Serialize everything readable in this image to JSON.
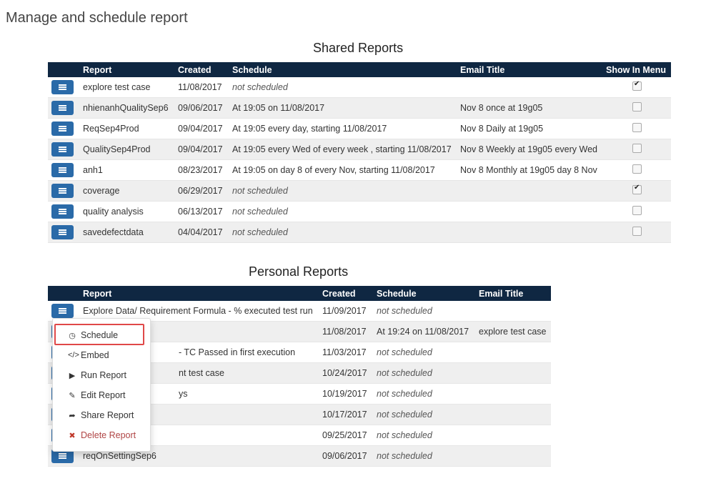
{
  "page": {
    "title": "Manage and schedule report"
  },
  "shared": {
    "title": "Shared Reports",
    "headers": {
      "report": "Report",
      "created": "Created",
      "schedule": "Schedule",
      "email": "Email Title",
      "show": "Show In Menu"
    },
    "rows": [
      {
        "name": "explore test case",
        "created": "11/08/2017",
        "schedule": "not scheduled",
        "email": "",
        "show": true
      },
      {
        "name": "nhienanhQualitySep6",
        "created": "09/06/2017",
        "schedule": "At 19:05 on 11/08/2017",
        "email": "Nov 8 once at 19g05",
        "show": false
      },
      {
        "name": "ReqSep4Prod",
        "created": "09/04/2017",
        "schedule": "At 19:05 every day, starting 11/08/2017",
        "email": "Nov 8 Daily at 19g05",
        "show": false
      },
      {
        "name": "QualitySep4Prod",
        "created": "09/04/2017",
        "schedule": "At 19:05 every Wed of every week , starting 11/08/2017",
        "email": "Nov 8 Weekly at 19g05 every Wed",
        "show": false
      },
      {
        "name": "anh1",
        "created": "08/23/2017",
        "schedule": "At 19:05 on day 8 of every Nov, starting 11/08/2017",
        "email": "Nov 8 Monthly at 19g05 day 8 Nov",
        "show": false
      },
      {
        "name": "coverage",
        "created": "06/29/2017",
        "schedule": "not scheduled",
        "email": "",
        "show": true
      },
      {
        "name": "quality analysis",
        "created": "06/13/2017",
        "schedule": "not scheduled",
        "email": "",
        "show": false
      },
      {
        "name": "savedefectdata",
        "created": "04/04/2017",
        "schedule": "not scheduled",
        "email": "",
        "show": false
      }
    ]
  },
  "personal": {
    "title": "Personal Reports",
    "headers": {
      "report": "Report",
      "created": "Created",
      "schedule": "Schedule",
      "email": "Email Title"
    },
    "rows": [
      {
        "name": "Explore Data/ Requirement Formula - % executed test run",
        "created": "11/09/2017",
        "schedule": "not scheduled",
        "email": ""
      },
      {
        "name": "",
        "created": "11/08/2017",
        "schedule": "At 19:24 on 11/08/2017",
        "email": "explore test case"
      },
      {
        "name": "- TC Passed in first execution",
        "created": "11/03/2017",
        "schedule": "not scheduled",
        "email": ""
      },
      {
        "name": "nt test case",
        "created": "10/24/2017",
        "schedule": "not scheduled",
        "email": ""
      },
      {
        "name": "ys",
        "created": "10/19/2017",
        "schedule": "not scheduled",
        "email": ""
      },
      {
        "name": "",
        "created": "10/17/2017",
        "schedule": "not scheduled",
        "email": ""
      },
      {
        "name": "",
        "created": "09/25/2017",
        "schedule": "not scheduled",
        "email": ""
      },
      {
        "name": "reqOnSettingSep6",
        "created": "09/06/2017",
        "schedule": "not scheduled",
        "email": ""
      }
    ]
  },
  "menu": {
    "items": [
      {
        "label": "Schedule",
        "icon": "clock-icon"
      },
      {
        "label": "Embed",
        "icon": "code-icon"
      },
      {
        "label": "Run Report",
        "icon": "play-icon"
      },
      {
        "label": "Edit Report",
        "icon": "pencil-icon"
      },
      {
        "label": "Share Report",
        "icon": "share-icon"
      },
      {
        "label": "Delete Report",
        "icon": "times-icon"
      }
    ]
  },
  "colors": {
    "header_bg": "#0f2742",
    "button_bg": "#2a6aa8",
    "highlight": "#e04848",
    "danger": "#b04545"
  }
}
